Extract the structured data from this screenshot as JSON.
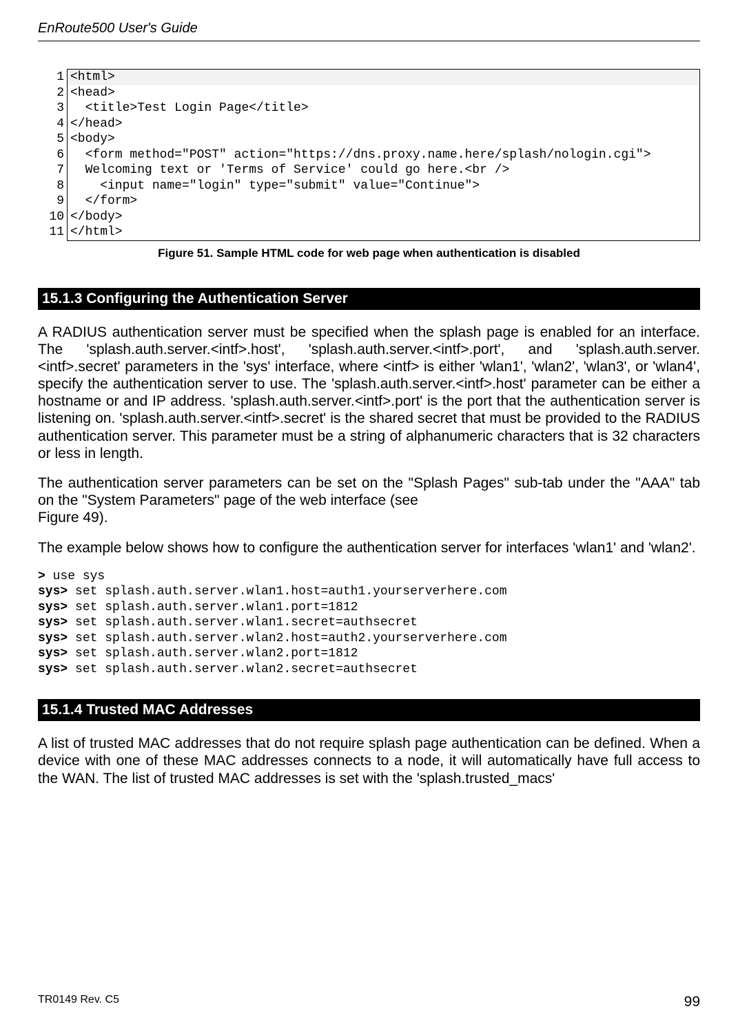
{
  "header": {
    "doc_title": "EnRoute500 User's Guide"
  },
  "codeblock": {
    "lines": [
      {
        "n": "1",
        "text": "<html>",
        "shade": true
      },
      {
        "n": "2",
        "text": "<head>",
        "shade": false
      },
      {
        "n": "3",
        "text": "  <title>Test Login Page</title>",
        "shade": false
      },
      {
        "n": "4",
        "text": "</head>",
        "shade": false
      },
      {
        "n": "5",
        "text": "<body>",
        "shade": false
      },
      {
        "n": "6",
        "text": "  <form method=\"POST\" action=\"https://dns.proxy.name.here/splash/nologin.cgi\">",
        "shade": false
      },
      {
        "n": "7",
        "text": "  Welcoming text or 'Terms of Service' could go here.<br />",
        "shade": false
      },
      {
        "n": "8",
        "text": "    <input name=\"login\" type=\"submit\" value=\"Continue\">",
        "shade": false
      },
      {
        "n": "9",
        "text": "  </form>",
        "shade": false
      },
      {
        "n": "10",
        "text": "</body>",
        "shade": false
      },
      {
        "n": "11",
        "text": "</html>",
        "shade": false
      }
    ]
  },
  "figure_caption": "Figure 51. Sample HTML code for web page when authentication is disabled",
  "section1": {
    "heading": "15.1.3    Configuring the Authentication Server",
    "para1": "A RADIUS authentication server must be specified when the splash page is enabled for an interface. The 'splash.auth.server.<intf>.host', 'splash.auth.server.<intf>.port', and 'splash.auth.server.<intf>.secret' parameters in the 'sys' interface, where <intf> is either 'wlan1', 'wlan2', 'wlan3', or 'wlan4', specify the authentication server to use. The 'splash.auth.server.<intf>.host' parameter can be either a hostname or and IP address. 'splash.auth.server.<intf>.port' is the port that the authentication server is listening on. 'splash.auth.server.<intf>.secret' is the shared secret that must be provided to the RADIUS authentication server. This parameter must be a string of alphanumeric characters that is 32 characters or less in length.",
    "para2": "The authentication server parameters can be set on the \"Splash Pages\" sub-tab under the \"AAA\" tab on the \"System Parameters\" page of the web interface (see",
    "para2b": "Figure 49).",
    "para3": "The example below shows how to configure the authentication server for interfaces 'wlan1' and 'wlan2'."
  },
  "cli": {
    "p0": "> ",
    "c0": "use sys",
    "p1": "sys> ",
    "c1": "set splash.auth.server.wlan1.host=auth1.yourserverhere.com",
    "c2": "set splash.auth.server.wlan1.port=1812",
    "c3": "set splash.auth.server.wlan1.secret=authsecret",
    "c4": "set splash.auth.server.wlan2.host=auth2.yourserverhere.com",
    "c5": "set splash.auth.server.wlan2.port=1812",
    "c6": "set splash.auth.server.wlan2.secret=authsecret"
  },
  "section2": {
    "heading": "15.1.4    Trusted MAC Addresses",
    "para1": "A list of trusted MAC addresses that do not require splash page authentication can be defined. When a device with one of these MAC addresses connects to a node, it will automatically have full access to the WAN. The list of trusted MAC addresses is set with the 'splash.trusted_macs'"
  },
  "footer": {
    "left": "TR0149 Rev. C5",
    "right": "99"
  }
}
